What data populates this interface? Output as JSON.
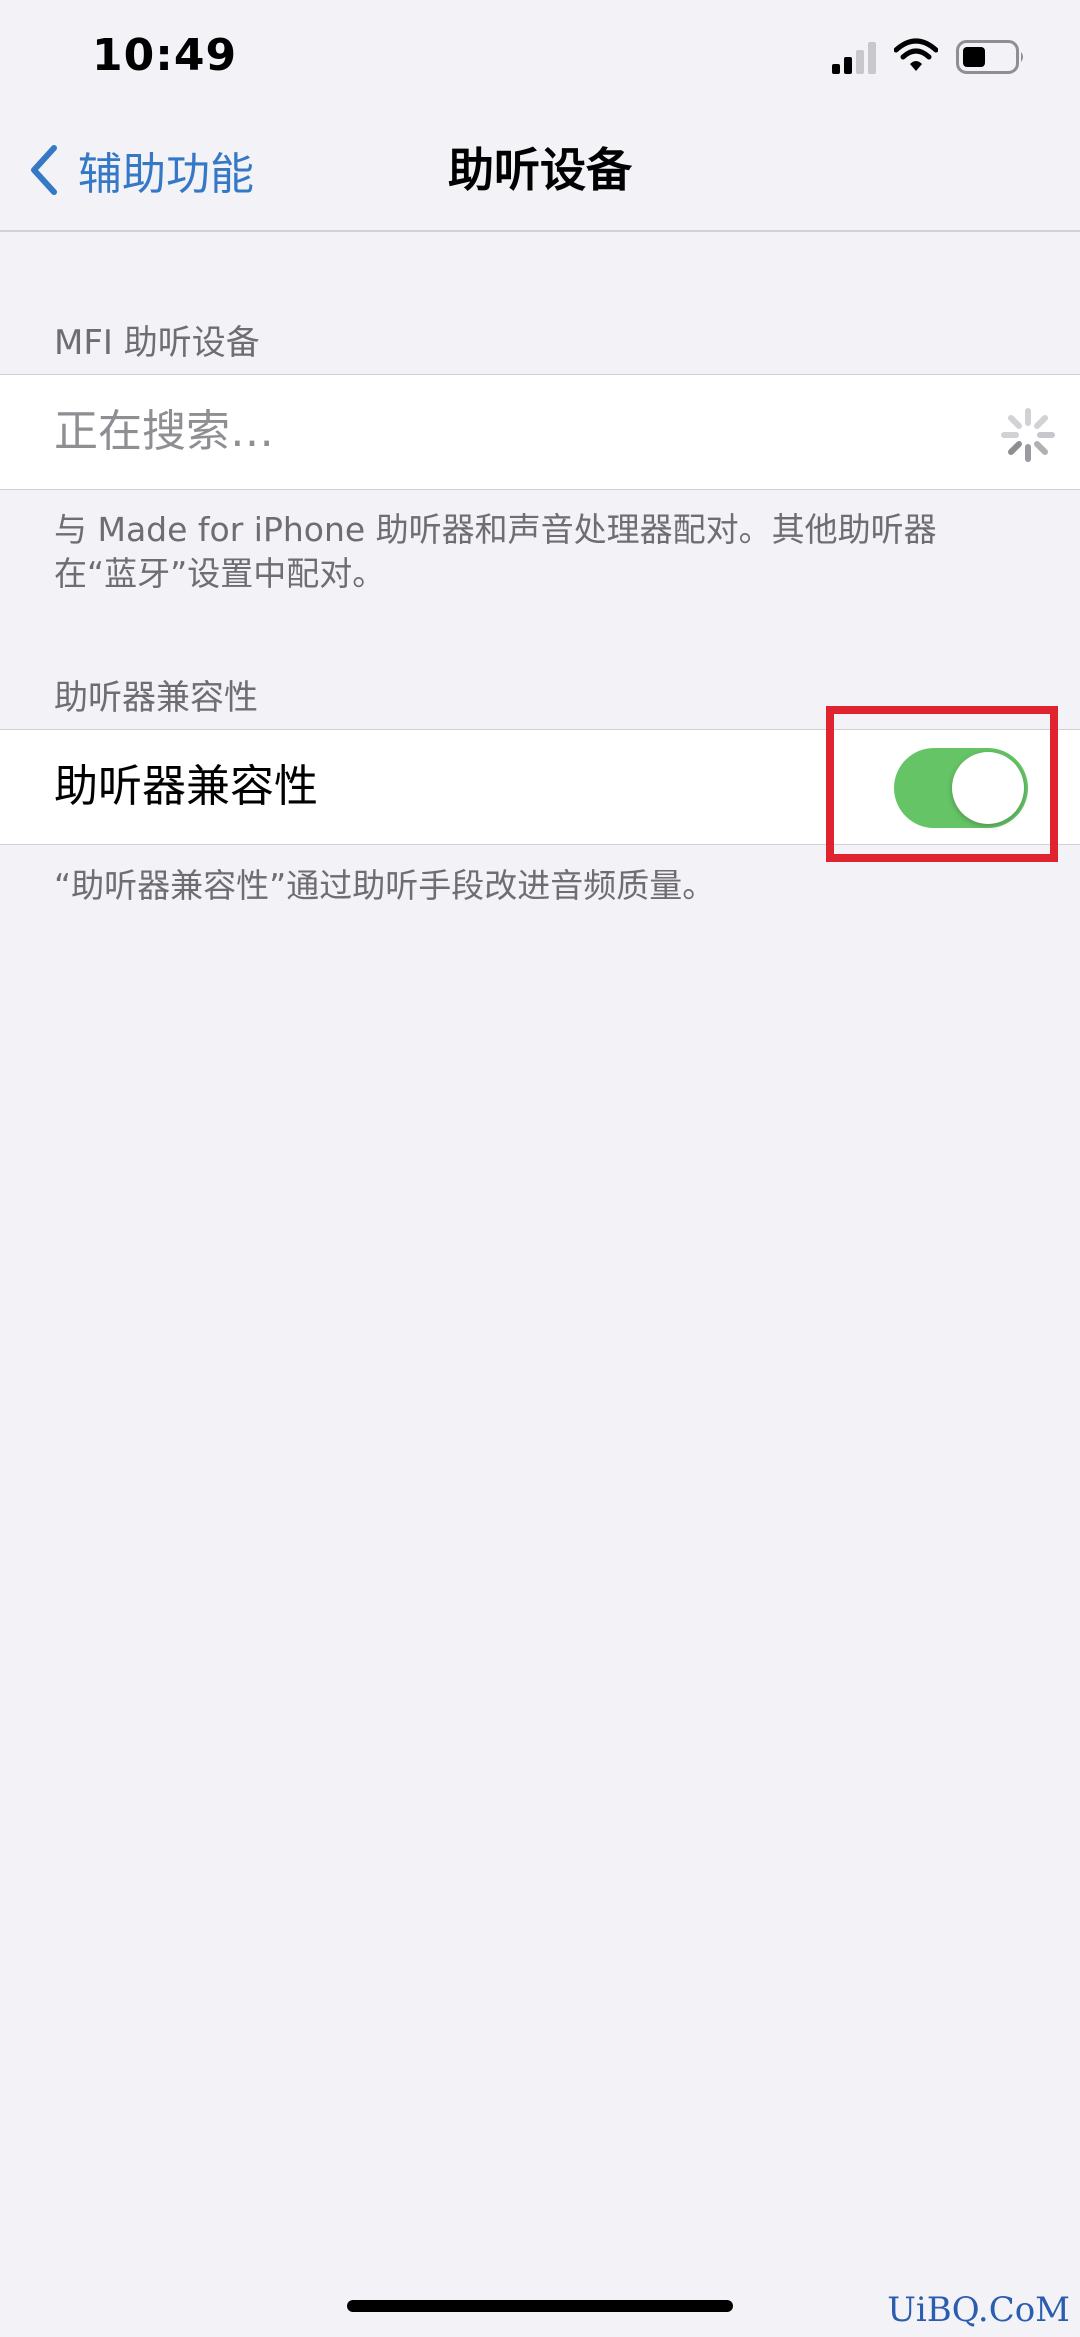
{
  "status_bar": {
    "time": "10:49",
    "icons": [
      "signal-icon",
      "wifi-icon",
      "battery-icon"
    ]
  },
  "nav": {
    "back_label": "辅助功能",
    "title": "助听设备",
    "back_icon": "chevron-left-icon"
  },
  "mfi_section": {
    "header": "MFI 助听设备",
    "searching_label": "正在搜索…",
    "spinner_icon": "spinner-icon",
    "footer": "与 Made for iPhone 助听器和声音处理器配对。其他助听器在“蓝牙”设置中配对。"
  },
  "compat_section": {
    "header": "助听器兼容性",
    "row_label": "助听器兼容性",
    "toggle_on": true,
    "footer": "“助听器兼容性”通过助听手段改进音频质量。"
  },
  "watermark": "UiBQ.CoM",
  "colors": {
    "accent": "#3478c6",
    "toggle_on": "#65c466",
    "highlight": "#e0242f",
    "background": "#f2f2f7"
  }
}
